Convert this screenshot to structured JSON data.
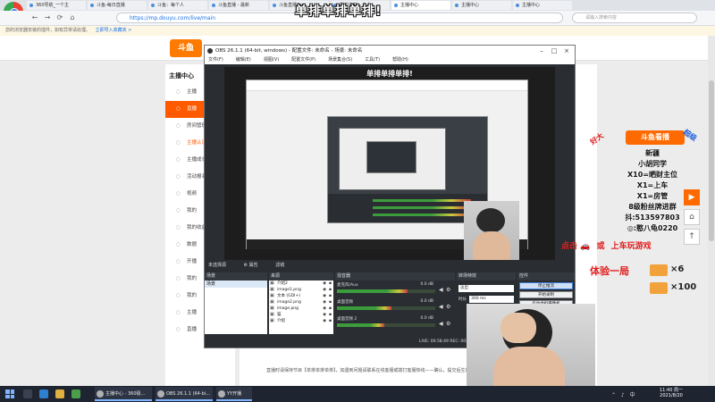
{
  "browser": {
    "logo_label": "",
    "tabs": [
      "360导航_一个主",
      "斗鱼-每日直播",
      "斗鱼：每个人",
      "斗鱼直播 - 最新",
      "斗鱼直播Acc",
      "我的资料 - 个人",
      "主播中心",
      "主播中心",
      "主播中心"
    ],
    "url": "https://mp.douyu.com/live/main",
    "search_placeholder": "请输入搜索内容",
    "infobar_text": "您的浏览器安装的插件，如有异常请处理。",
    "infobar_link": "立即导入收藏夹 >",
    "nav_back": "←",
    "nav_forward": "→",
    "nav_refresh": "⟳",
    "nav_home": "⌂"
  },
  "webpage": {
    "logo": "斗鱼",
    "sidebar_title": "主播中心",
    "sidebar_items": [
      "主播",
      "直播",
      "房间管理",
      "主播认证",
      "主播成长",
      "活动报名",
      "视频",
      "我的",
      "我的收益",
      "数据",
      "开播",
      "我的",
      "我的",
      "主播",
      "直播"
    ],
    "notice": "直播时请保持节目【单排单排单排】，如遇到问题请联系在线客服或拨打客服热线——确认，提交后生效"
  },
  "stream": {
    "heading": "单排单排单排!"
  },
  "obs": {
    "title": "OBS 26.1.1 (64-bit, windows) - 配置文件: 未命名 - 场景: 未命名",
    "menu": [
      "文件(F)",
      "编辑(E)",
      "视图(V)",
      "配置文件(P)",
      "场景集合(S)",
      "工具(T)",
      "帮助(H)"
    ],
    "preview_heading": "单排单排单排!",
    "scene_label": "未选择源",
    "scene_props": "⚙ 属性",
    "scene_filters": "滤镜",
    "docks": {
      "scenes": "场景",
      "sources": "来源",
      "mixer": "混音器",
      "transitions": "转场特效",
      "controls": "控件"
    },
    "scenes_list": [
      "场景"
    ],
    "sources_list": [
      "介绍2",
      "image1.png",
      "文本 (GDI+)",
      "image2.png",
      "image.png",
      "猫",
      "介绍"
    ],
    "mixer_tracks": [
      {
        "name": "麦克风/Aux",
        "db": "0.0 dB",
        "level": 0.72
      },
      {
        "name": "桌面音频",
        "db": "0.0 dB",
        "level": 0.55
      },
      {
        "name": "桌面音频 2",
        "db": "0.0 dB",
        "level": 0.48
      }
    ],
    "transition_type": "淡出",
    "transition_duration_label": "时长",
    "transition_duration": "300 ms",
    "controls": [
      "停止推流",
      "开始录制",
      "启动虚拟摄像机",
      "工作室模式",
      "设置",
      "退出"
    ],
    "status": "LIVE: 00:58:49   REC: 00:00:00   CPU: 6.5%, 30.00 fps   kb/s: 1298"
  },
  "overlay": {
    "badge": "斗鱼看播",
    "tag_left": "好大",
    "tag_right": "超级",
    "lines": [
      "新疆",
      "小胡同学",
      "X10=晒财主位",
      "X1=上车",
      "X1=房管",
      "8级粉丝牌进群",
      "抖:513597803",
      "◎:憨八龟0220"
    ],
    "cta_prefix": "点击",
    "cta_car": "🚗",
    "cta_or": "或",
    "cta_suffix": "上车玩游戏",
    "trial": "体验一局",
    "gift1_mult": "×6",
    "gift2_mult": "×100"
  },
  "float_buttons": [
    "▶",
    "⌂",
    "↑"
  ],
  "taskbar": {
    "tasks": [
      "主播中心 - 360极...",
      "OBS 26.1.1 (64-bi...",
      "YY开播"
    ],
    "time": "11:40 周一",
    "date": "2021/8/20",
    "tray": "⌃ ♪ 中"
  }
}
